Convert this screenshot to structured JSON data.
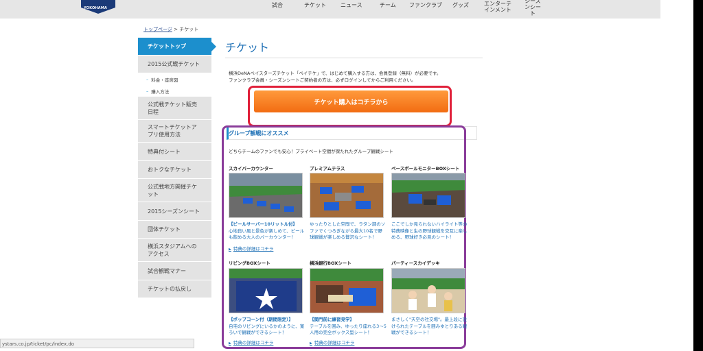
{
  "logo": {
    "text": "YOKOHAMA",
    "color": "#1b3a78"
  },
  "nav": [
    {
      "label": "試合"
    },
    {
      "label": "チケット"
    },
    {
      "label": "ニュース"
    },
    {
      "label": "チーム"
    },
    {
      "label": "ファンクラブ"
    },
    {
      "label": "グッズ"
    },
    {
      "label": "エンターテインメント"
    },
    {
      "label": "シーズンシート"
    }
  ],
  "breadcrumb": {
    "home": "トップページ",
    "sep": " > ",
    "current": "チケット"
  },
  "sidebar": {
    "accent": "#1c8fcd",
    "items": [
      {
        "label": "チケットトップ"
      },
      {
        "label": "2015公式戦チケット"
      },
      {
        "label": "料金・座席図"
      },
      {
        "label": "購入方法"
      },
      {
        "label": "公式戦チケット販売日程"
      },
      {
        "label": "スマートチケットアプリ使用方法"
      },
      {
        "label": "特典付シート"
      },
      {
        "label": "おトクなチケット"
      },
      {
        "label": "公式戦地方開催チケット"
      },
      {
        "label": "2015シーズンシート"
      },
      {
        "label": "団体チケット"
      },
      {
        "label": "横浜スタジアムへのアクセス"
      },
      {
        "label": "試合観戦マナー"
      },
      {
        "label": "チケットの払戻し"
      }
    ]
  },
  "main": {
    "title": "チケット",
    "intro1": "横浜DeNAベイスターズチケット「ベイチケ」で、はじめて購入する方は、会員登録（無料）が必要です。",
    "intro2": "ファンクラブ会員・シーズンシートご契約者の方は、必ずログインしてからご利用ください。",
    "buy_button": "チケット購入はコチラから",
    "buy_color": "#f26c12"
  },
  "group": {
    "title": "グループ観戦にオススメ",
    "desc": "どちらチームのファンでも安心！プライベート空間が保たれたグループ観戦シート",
    "seats": [
      {
        "name": "スカイバーカウンター",
        "caption_hl": "【ビールサーバー10リットル付】",
        "caption": "心地良い風と景色が楽しめて、ビールも飲める大人のバーカウンター！",
        "link": "特典の詳細はコチラ"
      },
      {
        "name": "プレミアムテラス",
        "caption_hl": "",
        "caption": "ゆったりとした空間で、ラタン調のソファでくつろぎながら最大10名で野球観戦が楽しめる贅沢なシート！",
        "link": ""
      },
      {
        "name": "ベースボールモニターBOXシート",
        "caption_hl": "",
        "caption": "ここでしか見られないハイライト等の特典映像と生の野球観戦を交互に楽しめる、野球好き必見のシート！",
        "link": ""
      },
      {
        "name": "リビングBOXシート",
        "caption_hl": "【ポップコーン付（期間限定）】",
        "caption": "自宅のリビングにいるかのように、寛ろいで観戦ができるシート！",
        "link": "特典の詳細はコチラ"
      },
      {
        "name": "横浜銀行BOXシート",
        "caption_hl": "【関門前に練習見学】",
        "caption": "テーブルを囲み、ゆったり座れる3～5人用の完全ボックス型シート！",
        "link": "特典の詳細はコチラ"
      },
      {
        "name": "パーティースカイデッキ",
        "caption_hl": "",
        "caption": "まさしく\"天空の社交場\"。最上段に設けられたテーブルを囲みゆとりある観戦ができるシート！",
        "link": ""
      }
    ]
  },
  "statusbar": {
    "url": "ystars.co.jp/ticket/pc/index.do"
  }
}
